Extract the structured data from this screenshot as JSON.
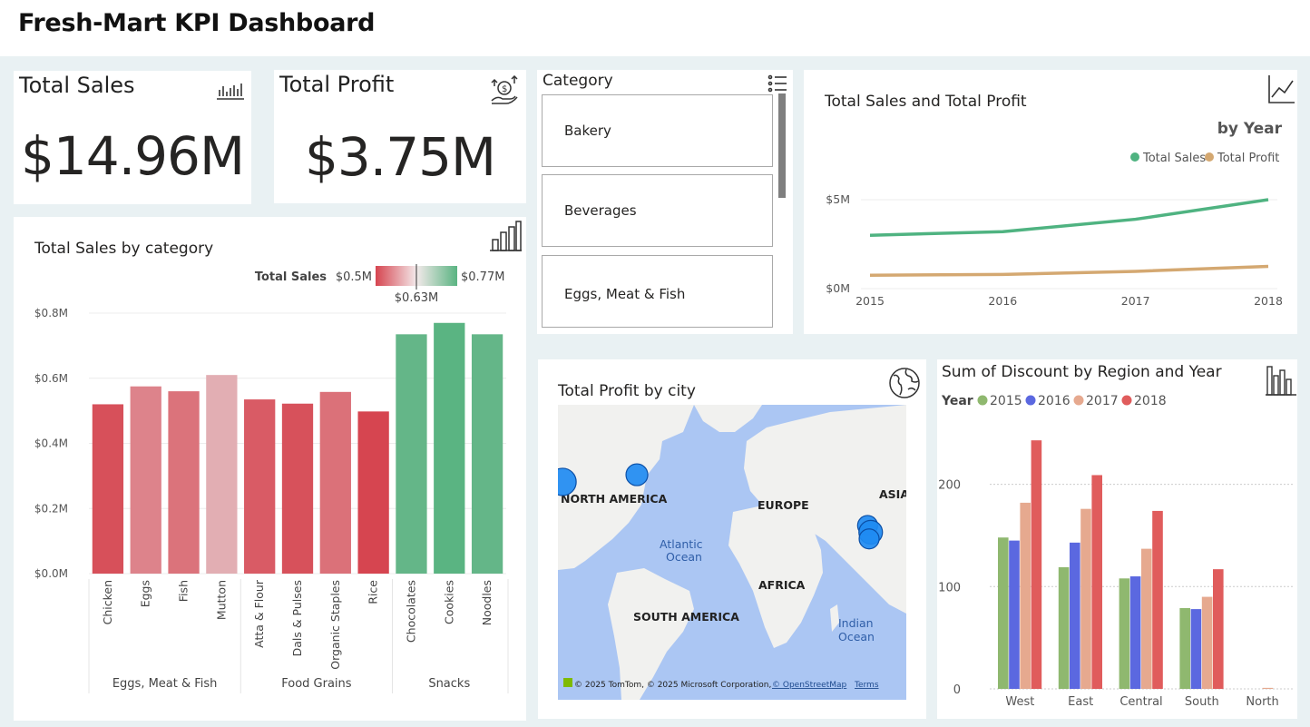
{
  "header": {
    "title": "Fresh-Mart KPI Dashboard"
  },
  "kpis": {
    "sales": {
      "label": "Total Sales",
      "value": "$14.96M"
    },
    "profit": {
      "label": "Total Profit",
      "value": "$3.75M"
    }
  },
  "slicer": {
    "title": "Category",
    "items": [
      "Bakery",
      "Beverages",
      "Eggs, Meat & Fish"
    ]
  },
  "map": {
    "title": "Total Profit by city",
    "labels": {
      "north_america": "NORTH AMERICA",
      "europe": "EUROPE",
      "asia": "ASIA",
      "atlantic1": "Atlantic",
      "atlantic2": "Ocean",
      "africa": "AFRICA",
      "south_america": "SOUTH AMERICA",
      "indian1": "Indian",
      "indian2": "Ocean"
    },
    "attribution": "© 2025 TomTom, © 2025 Microsoft Corporation,",
    "osm": "© OpenStreetMap",
    "terms": "Terms",
    "water_color": "#abc6f3",
    "land_color": "#f1f1ef",
    "bubble_color": "#1f8bf2"
  },
  "colors": {
    "low": "#d64550",
    "mid": "#e6cfd2",
    "high": "#5ab482",
    "sales_line": "#4fb381",
    "profit_line": "#d4a871",
    "y2015": "#8fb86f",
    "y2016": "#5b68e0",
    "y2017": "#e6a98f",
    "y2018": "#e05c5c"
  },
  "icons": [
    "bar-chart-icon",
    "money-hand-icon",
    "list-icon",
    "line-chart-icon",
    "globe-icon"
  ],
  "chart_data": [
    {
      "id": "sales_by_category",
      "type": "bar",
      "title": "Total Sales by category",
      "legend": {
        "title": "Total Sales",
        "min": "$0.5M",
        "mid": "$0.63M",
        "max": "$0.77M"
      },
      "categories": [
        "Chicken",
        "Eggs",
        "Fish",
        "Mutton",
        "Atta & Flour",
        "Dals & Pulses",
        "Organic Staples",
        "Rice",
        "Chocolates",
        "Cookies",
        "Noodles"
      ],
      "groups": [
        {
          "name": "Eggs, Meat & Fish",
          "count": 4
        },
        {
          "name": "Food Grains",
          "count": 4
        },
        {
          "name": "Snacks",
          "count": 3
        }
      ],
      "values": [
        0.52,
        0.575,
        0.56,
        0.61,
        0.535,
        0.522,
        0.558,
        0.498,
        0.735,
        0.77,
        0.735
      ],
      "yticks": [
        "$0.0M",
        "$0.2M",
        "$0.4M",
        "$0.6M",
        "$0.8M"
      ],
      "ylim": [
        0,
        0.8
      ]
    },
    {
      "id": "sales_profit_by_year",
      "type": "line",
      "title": "Total Sales and Total Profit",
      "subtitle": "by Year",
      "x": [
        "2015",
        "2016",
        "2017",
        "2018"
      ],
      "series": [
        {
          "name": "Total Sales",
          "values": [
            3.0,
            3.2,
            3.9,
            5.0
          ]
        },
        {
          "name": "Total Profit",
          "values": [
            0.75,
            0.8,
            0.97,
            1.25
          ]
        }
      ],
      "yticks": [
        "$0M",
        "$5M"
      ],
      "ylim": [
        0,
        5
      ]
    },
    {
      "id": "discount_by_region",
      "type": "bar",
      "title": "Sum of Discount by Region and Year",
      "legend_title": "Year",
      "categories": [
        "West",
        "East",
        "Central",
        "South",
        "North"
      ],
      "series": [
        {
          "name": "2015",
          "values": [
            148,
            119,
            108,
            79,
            0
          ]
        },
        {
          "name": "2016",
          "values": [
            145,
            143,
            110,
            78,
            0
          ]
        },
        {
          "name": "2017",
          "values": [
            182,
            176,
            137,
            90,
            1
          ]
        },
        {
          "name": "2018",
          "values": [
            243,
            209,
            174,
            117,
            0
          ]
        }
      ],
      "yticks": [
        "0",
        "100",
        "200"
      ],
      "ylim": [
        0,
        260
      ]
    }
  ],
  "map_points": [
    {
      "name": "west-coast-city",
      "lon": -122,
      "lat": 37.5,
      "size": 15
    },
    {
      "name": "east-coast-city",
      "lon": -74,
      "lat": 40.7,
      "size": 12
    },
    {
      "name": "india-city-1",
      "lon": 75,
      "lat": 18,
      "size": 11
    },
    {
      "name": "india-city-2",
      "lon": 77,
      "lat": 15,
      "size": 13
    },
    {
      "name": "india-city-3",
      "lon": 76,
      "lat": 12,
      "size": 11
    }
  ]
}
